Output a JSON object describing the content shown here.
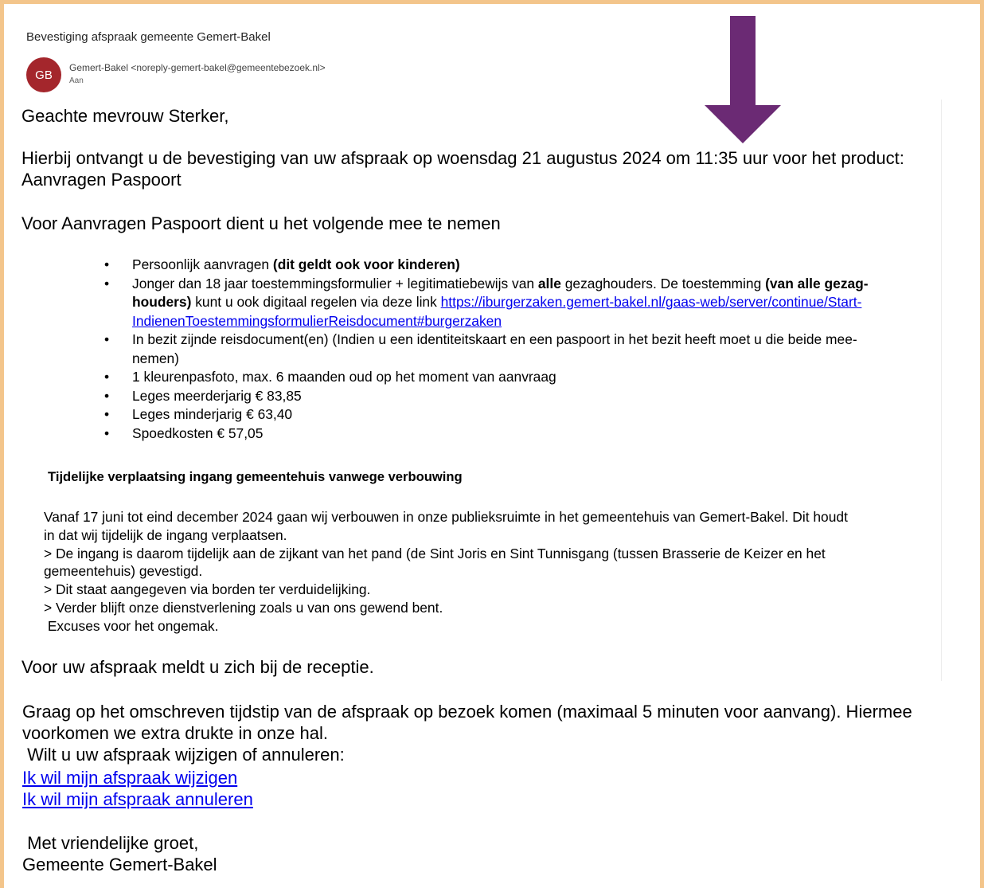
{
  "email": {
    "subject": "Bevestiging afspraak gemeente Gemert-Bakel",
    "avatar_initials": "GB",
    "avatar_color": "#a4262c",
    "sender": "Gemert-Bakel <noreply-gemert-bakel@gemeentebezoek.nl>",
    "to_label": "Aan"
  },
  "annotation": {
    "arrow_color": "#6b2a74",
    "icon": "arrow-down-icon"
  },
  "body": {
    "greeting": "Geachte mevrouw Sterker,",
    "confirmation_line1": "Hierbij ontvangt u de bevestiging van uw afspraak op woensdag 21 augustus 2024 om 11:35 uur voor het product:",
    "confirmation_line2": "Aanvragen Paspoort",
    "bring_intro": "Voor Aanvragen Paspoort dient u het volgende mee te nemen",
    "bullets": {
      "b1_text": "Persoonlijk aanvragen ",
      "b1_bold": "(dit geldt ook voor kinderen)",
      "b2_line1_a": "Jonger dan 18 jaar toestemmingsformulier + legitimatiebewijs  van ",
      "b2_line1_bold": "alle",
      "b2_line1_b": " gezaghouders. De toestemming ",
      "b2_line1_bold2": "(van alle gezag-",
      "b2_line2_bold": "houders)",
      "b2_line2_text": " kunt u ook digitaal regelen via deze link ",
      "b2_link_part1": "https://iburgerzaken.gemert-bakel.nl/gaas-web/server/continue/Start-",
      "b2_link_part2": "IndienenToestemmingsformulierReisdocument#burgerzaken",
      "b3_line1": "In bezit zijnde reisdocument(en) (Indien u een identiteitskaart en een paspoort in het bezit heeft moet u die beide mee-",
      "b3_line2": "nemen)",
      "b4": "1 kleurenpasfoto, max. 6 maanden oud op het moment van aanvraag",
      "b5": "Leges meerderjarig € 83,85",
      "b6": "Leges minderjarig € 63,40",
      "b7": "Spoedkosten € 57,05"
    },
    "notice_title": "Tijdelijke verplaatsing ingang gemeentehuis vanwege verbouwing",
    "notice_lines": {
      "l1": "Vanaf 17 juni tot eind december 2024 gaan wij verbouwen in onze publieksruimte in het gemeentehuis van Gemert-Bakel. Dit houdt",
      "l2": "in dat wij tijdelijk de ingang verplaatsen.",
      "l3": "> De ingang is daarom tijdelijk aan de zijkant van het pand (de Sint Joris en Sint Tunnisgang (tussen Brasserie de Keizer en het",
      "l4": "gemeentehuis) gevestigd.",
      "l5": "> Dit staat aangegeven via borden ter verduidelijking.",
      "l6": "> Verder blijft onze dienstverlening zoals u van ons gewend bent.",
      "l7": " Excuses voor het ongemak."
    },
    "reception": "Voor uw afspraak meldt u zich bij de receptie.",
    "punctual_line1": "Graag op het omschreven tijdstip van de afspraak op bezoek komen (maximaal 5 minuten voor aanvang). Hiermee",
    "punctual_line2": "voorkomen we extra drukte in onze hal.",
    "change_prompt": " Wilt u uw afspraak wijzigen of annuleren:",
    "change_link": "Ik wil mijn afspraak wijzigen",
    "cancel_link": "Ik wil mijn afspraak annuleren",
    "regards": " Met vriendelijke groet,",
    "signature": "Gemeente Gemert-Bakel"
  }
}
